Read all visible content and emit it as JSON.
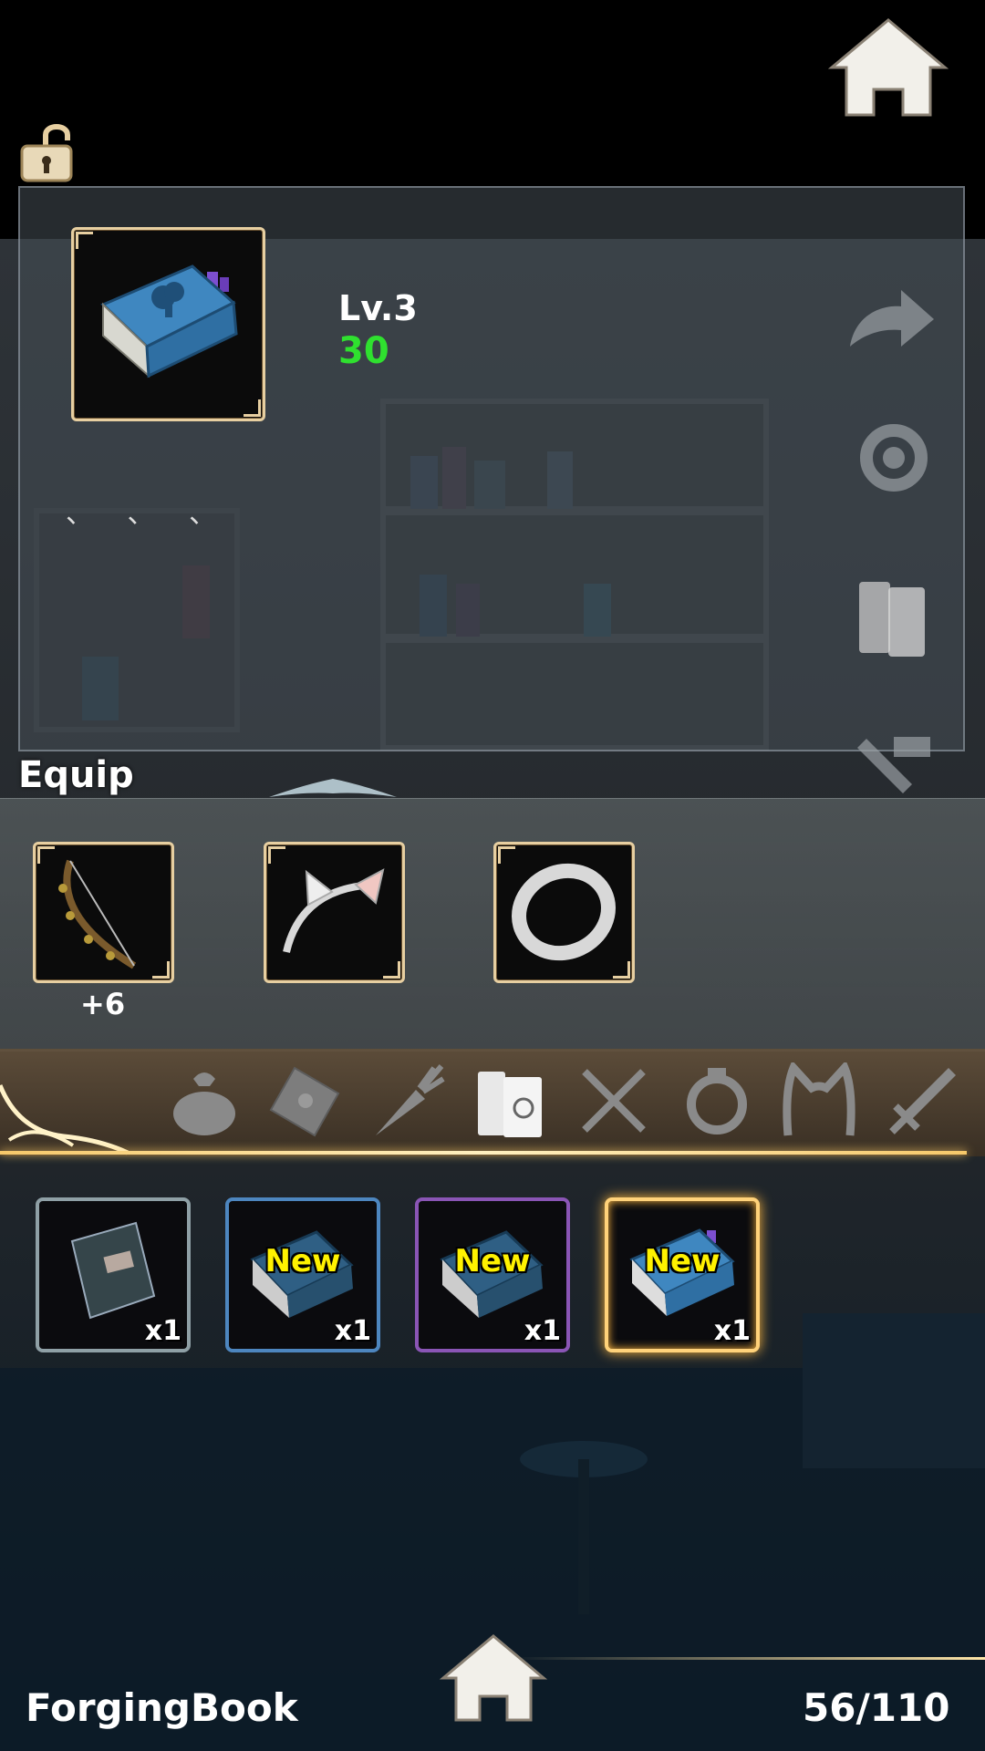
{
  "detail": {
    "level": "Lv.3",
    "value": "30",
    "description": "、 、 、"
  },
  "equip": {
    "title": "Equip",
    "items": [
      {
        "name": "bow",
        "bonus": "+6"
      },
      {
        "name": "cat-ear-headband",
        "bonus": ""
      },
      {
        "name": "ring",
        "bonus": ""
      }
    ]
  },
  "categories": [
    "bag-icon",
    "envelope-icon",
    "carrot-icon",
    "books-icon",
    "fork-knife-icon",
    "ring-icon",
    "cat-ears-icon",
    "sword-icon"
  ],
  "inventory": [
    {
      "rarity": "gray",
      "new": "",
      "qty": "x1"
    },
    {
      "rarity": "blue",
      "new": "New",
      "qty": "x1"
    },
    {
      "rarity": "purple",
      "new": "New",
      "qty": "x1"
    },
    {
      "rarity": "gold",
      "new": "New",
      "qty": "x1",
      "selected": true
    }
  ],
  "footer": {
    "title": "ForgingBook",
    "count": "56/110"
  },
  "colors": {
    "level_value": "#2fe02f",
    "new_badge": "#fff200",
    "frame_gold": "#e7cfa1"
  }
}
